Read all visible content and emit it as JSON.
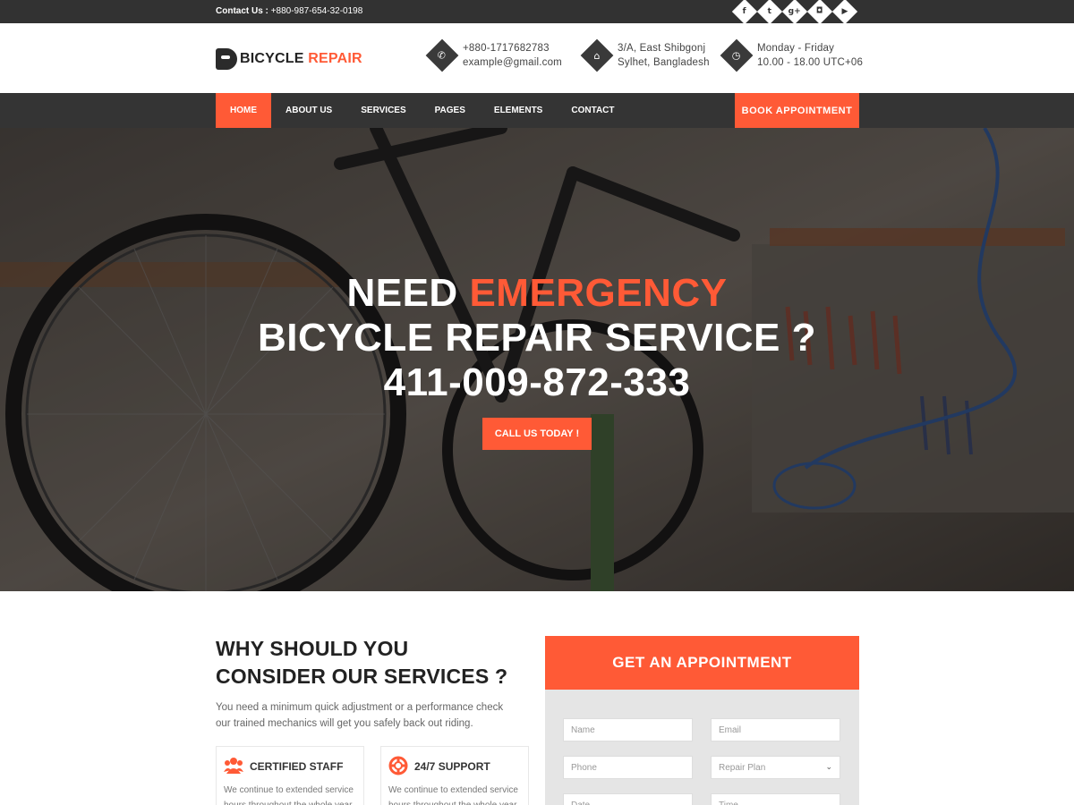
{
  "topbar": {
    "contact_label": "Contact Us :",
    "contact_phone": "+880-987-654-32-0198",
    "socials": [
      "facebook-icon",
      "twitter-icon",
      "google-plus-icon",
      "instagram-icon",
      "youtube-icon"
    ]
  },
  "header": {
    "logo_text_1": "BICYCLE",
    "logo_text_2": "REPAIR",
    "phone": "+880-1717682783",
    "email": "example@gmail.com",
    "address_1": "3/A, East Shibgonj",
    "address_2": "Sylhet, Bangladesh",
    "hours_1": "Monday - Friday",
    "hours_2": "10.00 - 18.00 UTC+06"
  },
  "nav": {
    "items": [
      "HOME",
      "ABOUT US",
      "SERVICES",
      "PAGES",
      "ELEMENTS",
      "CONTACT"
    ],
    "active": "HOME",
    "book_label": "BOOK APPOINTMENT"
  },
  "hero": {
    "line1_a": "NEED",
    "line1_b": "EMERGENCY",
    "line2": "BICYCLE REPAIR SERVICE ?",
    "line3": "411-009-872-333",
    "cta": "CALL US TODAY !"
  },
  "why": {
    "title_1": "WHY SHOULD YOU",
    "title_2": "CONSIDER OUR SERVICES ?",
    "desc": "You need a minimum quick adjustment or a performance check our trained mechanics will get you safely back out riding.",
    "cards": [
      {
        "title": "CERTIFIED STAFF",
        "desc": "We continue to extended service hours throughout the whole year",
        "icon": "users-icon"
      },
      {
        "title": "24/7 SUPPORT",
        "desc": "We continue to extended service hours throughout the whole year",
        "icon": "lifebuoy-icon"
      }
    ]
  },
  "appointment": {
    "title": "GET AN APPOINTMENT",
    "name_placeholder": "Name",
    "email_placeholder": "Email",
    "phone_placeholder": "Phone",
    "plan_selected": "Repair Plan",
    "date_placeholder": "Date",
    "time_placeholder": "Time"
  },
  "colors": {
    "accent": "#ff5a36",
    "dark": "#343434"
  }
}
